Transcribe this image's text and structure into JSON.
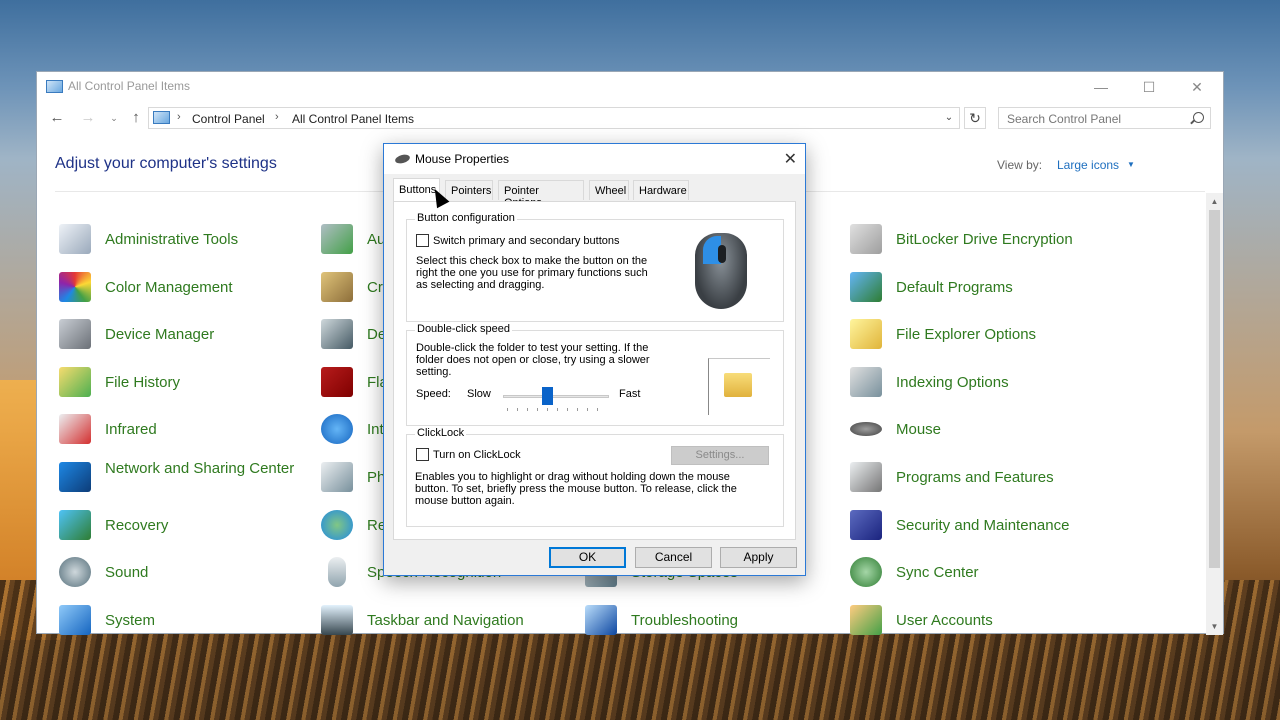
{
  "window": {
    "title": "All Control Panel Items",
    "min": "—",
    "max": "☐",
    "close": "✕"
  },
  "navigation": {
    "back": "←",
    "forward": "→",
    "recent": "⌄",
    "up": "↑",
    "separator": "›",
    "breadcrumb": [
      "Control Panel",
      "All Control Panel Items"
    ],
    "dropdown": "⌄",
    "refresh": "↻",
    "search_placeholder": "Search Control Panel"
  },
  "header": {
    "heading": "Adjust your computer's settings",
    "view_by_label": "View by:",
    "view_by_value": "Large icons",
    "view_by_chevron": "▼"
  },
  "scrollbar": {
    "up": "▲",
    "down": "▼"
  },
  "items": {
    "col1": [
      {
        "label": "Administrative Tools",
        "icon": "administrative-tools-icon"
      },
      {
        "label": "Color Management",
        "icon": "color-management-icon"
      },
      {
        "label": "Device Manager",
        "icon": "device-manager-icon"
      },
      {
        "label": "File History",
        "icon": "file-history-icon"
      },
      {
        "label": "Infrared",
        "icon": "infrared-icon"
      },
      {
        "label": "Network and Sharing Center",
        "icon": "network-sharing-icon"
      },
      {
        "label": "Recovery",
        "icon": "recovery-icon"
      },
      {
        "label": "Sound",
        "icon": "sound-icon"
      },
      {
        "label": "System",
        "icon": "system-icon"
      }
    ],
    "col2": [
      {
        "label": "Au",
        "icon": "autoplay-icon"
      },
      {
        "label": "Cr",
        "icon": "credential-manager-icon"
      },
      {
        "label": "De",
        "icon": "devices-printers-icon"
      },
      {
        "label": "Fla",
        "icon": "flash-player-icon"
      },
      {
        "label": "Int",
        "icon": "internet-options-icon"
      },
      {
        "label": "Ph",
        "icon": "phone-modem-icon"
      },
      {
        "label": "Re",
        "icon": "region-icon"
      },
      {
        "label": "Speech Recognition",
        "icon": "speech-recognition-icon"
      },
      {
        "label": "Taskbar and Navigation",
        "icon": "taskbar-icon"
      }
    ],
    "col3": [
      {
        "label": "Storage Spaces",
        "icon": "storage-spaces-icon"
      },
      {
        "label": "Troubleshooting",
        "icon": "troubleshooting-icon"
      }
    ],
    "col4": [
      {
        "label": "BitLocker Drive Encryption",
        "icon": "bitlocker-icon"
      },
      {
        "label": "Default Programs",
        "icon": "default-programs-icon"
      },
      {
        "label": "File Explorer Options",
        "icon": "file-explorer-options-icon"
      },
      {
        "label": "Indexing Options",
        "icon": "indexing-options-icon"
      },
      {
        "label": "Mouse",
        "icon": "mouse-icon"
      },
      {
        "label": "Programs and Features",
        "icon": "programs-features-icon"
      },
      {
        "label": "Security and Maintenance",
        "icon": "security-maintenance-icon"
      },
      {
        "label": "Sync Center",
        "icon": "sync-center-icon"
      },
      {
        "label": "User Accounts",
        "icon": "user-accounts-icon"
      }
    ]
  },
  "dialog": {
    "title": "Mouse Properties",
    "close": "✕",
    "tabs": [
      "Buttons",
      "Pointers",
      "Pointer Options",
      "Wheel",
      "Hardware"
    ],
    "active_tab": "Buttons",
    "button_config": {
      "caption": "Button configuration",
      "checkbox_label": "Switch primary and secondary buttons",
      "checked": false,
      "description": [
        "Select this check box to make the button on the",
        "right the one you use for primary functions such",
        "as selecting and dragging."
      ]
    },
    "double_click": {
      "caption": "Double-click speed",
      "description": [
        "Double-click the folder to test your setting. If the",
        "folder does not open or close, try using a slower",
        "setting."
      ],
      "speed_label": "Speed:",
      "slow_label": "Slow",
      "fast_label": "Fast",
      "speed_value": 0.4
    },
    "clicklock": {
      "caption": "ClickLock",
      "checkbox_label": "Turn on ClickLock",
      "checked": false,
      "settings_button": "Settings...",
      "description": [
        "Enables you to highlight or drag without holding down the mouse",
        "button. To set, briefly press the mouse button. To release, click the",
        "mouse button again."
      ]
    },
    "buttons": {
      "ok": "OK",
      "cancel": "Cancel",
      "apply": "Apply"
    }
  },
  "colors": {
    "link_green": "#2f7a1f",
    "heading_blue": "#1e3287",
    "accent_blue": "#0078d7"
  }
}
